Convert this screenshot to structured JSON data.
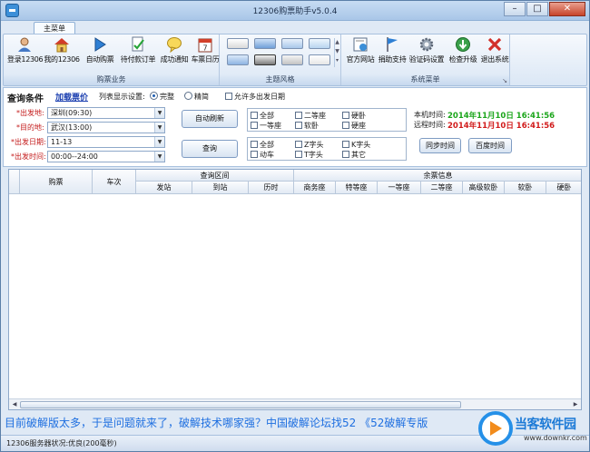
{
  "window": {
    "title": "12306购票助手v5.0.4"
  },
  "tabs": [
    {
      "label": "主菜单"
    }
  ],
  "ribbon": {
    "groups": [
      {
        "label": "购票业务",
        "buttons": [
          {
            "label": "登录12306",
            "icon": "person-icon"
          },
          {
            "label": "我的12306",
            "icon": "house-icon"
          },
          {
            "label": "自动购票",
            "icon": "play-icon"
          },
          {
            "label": "待付款订单",
            "icon": "document-check-icon"
          },
          {
            "label": "成功通知",
            "icon": "speech-bubble-icon"
          },
          {
            "label": "车票日历",
            "icon": "calendar-icon"
          }
        ]
      },
      {
        "label": "主题风格"
      },
      {
        "label": "系统菜单",
        "buttons": [
          {
            "label": "官方网站",
            "icon": "web-page-icon"
          },
          {
            "label": "捐助支持",
            "icon": "flag-icon"
          },
          {
            "label": "验证码设置",
            "icon": "gear-icon"
          },
          {
            "label": "检查升级",
            "icon": "download-globe-icon"
          },
          {
            "label": "退出系统",
            "icon": "close-x-icon"
          }
        ]
      }
    ],
    "calendar_day": "7"
  },
  "query": {
    "title": "查询条件",
    "load_link": "加载票价",
    "display_label": "列表显示设置:",
    "display_options": [
      {
        "label": "完整",
        "selected": true
      },
      {
        "label": "精简",
        "selected": false
      }
    ],
    "multi_date_label": "允许多出发日期",
    "fields": [
      {
        "label": "*出发地:",
        "value": "深圳(09:30)"
      },
      {
        "label": "*目的地:",
        "value": "武汉(13:00)"
      },
      {
        "label": "*出发日期:",
        "value": "11-13"
      },
      {
        "label": "*出发时间:",
        "value": "00:00--24:00"
      }
    ],
    "auto_refresh": "自动刷新",
    "search": "查询",
    "seat_types": [
      [
        "全部",
        "二等座",
        "硬卧"
      ],
      [
        "一等座",
        "软卧",
        "硬座"
      ]
    ],
    "train_types": [
      [
        "全部",
        "Z字头",
        "K字头"
      ],
      [
        "动车",
        "T字头",
        "其它"
      ]
    ],
    "local_time_label": "本机时间:",
    "local_time": "2014年11月10日 16:41:56",
    "remote_time_label": "远程时间:",
    "remote_time": "2014年11月10日 16:41:56",
    "sync_btn": "同步时间",
    "baidu_btn": "百度时间"
  },
  "grid": {
    "columns_top": [
      {
        "label": "购票"
      },
      {
        "label": "车次"
      },
      {
        "label": "查询区间"
      },
      {
        "label": "余票信息"
      }
    ],
    "columns_sub": [
      "发站",
      "到站",
      "历时",
      "商务座",
      "特等座",
      "一等座",
      "二等座",
      "高级软卧",
      "软卧",
      "硬卧"
    ]
  },
  "marquee": "目前破解版太多，于是问题就来了，破解技术哪家强？中国破解论坛找52  《52破解专版",
  "status": {
    "text": "12306服务器状况:优良(200毫秒)"
  },
  "watermark": {
    "brand": "当客软件园",
    "url": "www.downkr.com"
  },
  "colors": {
    "local_time": "#1aa51a",
    "remote_time": "#d11a1a",
    "required": "#c41c1c",
    "link": "#1b3fb0",
    "marquee": "#1e6fe0"
  }
}
